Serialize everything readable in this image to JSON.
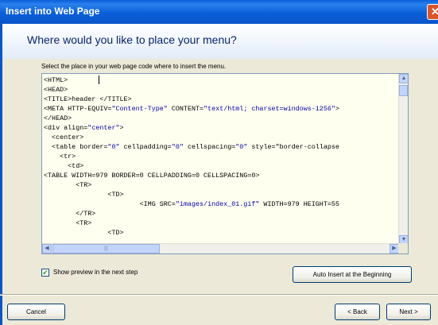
{
  "window": {
    "title": "Insert into Web Page"
  },
  "header": {
    "heading": "Where would you like to place your menu?"
  },
  "instruction": "Select the place in your web page code where to insert the menu.",
  "code_lines": [
    "<HTML>",
    "<HEAD>",
    "<TITLE>header </TITLE>",
    "<META HTTP-EQUIV=\"Content-Type\" CONTENT=\"text/html; charset=windows-1256\">",
    "</HEAD>",
    "<div align=\"center\">",
    "  <center>",
    "  <table border=\"0\" cellpadding=\"0\" cellspacing=\"0\" style=\"border-collapse",
    "    <tr>",
    "      <td>",
    "<TABLE WIDTH=979 BORDER=0 CELLPADDING=0 CELLSPACING=0>",
    "        <TR>",
    "                <TD>",
    "                        <IMG SRC=\"images/index_01.gif\" WIDTH=979 HEIGHT=55",
    "        </TR>",
    "        <TR>",
    "                <TD>"
  ],
  "checkbox": {
    "label": "Show preview in the next step",
    "checked": true
  },
  "buttons": {
    "auto_insert": "Auto Insert at the Beginning",
    "cancel": "Cancel",
    "back": "< Back",
    "next": "Next >"
  },
  "icons": {
    "close": "close-icon",
    "scroll_up": "arrow-up-icon",
    "scroll_down": "arrow-down-icon",
    "scroll_left": "arrow-left-icon",
    "scroll_right": "arrow-right-icon"
  },
  "colors": {
    "titlebar": "#0a5fd8",
    "heading": "#0a246a",
    "attribute_value": "#0000aa",
    "code_background": "#fffff0"
  }
}
